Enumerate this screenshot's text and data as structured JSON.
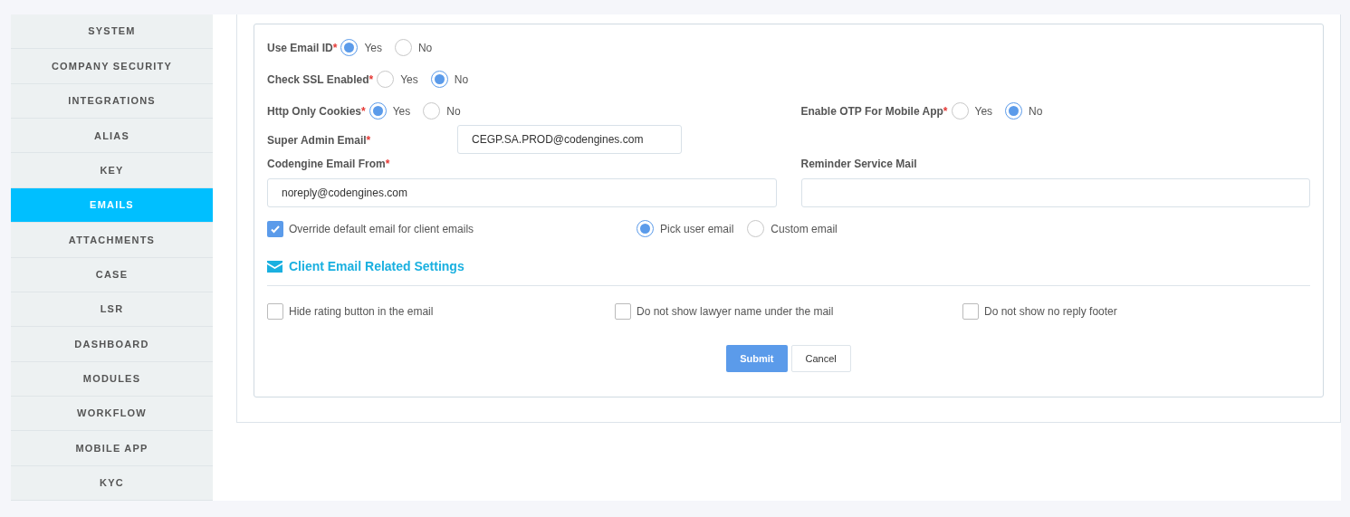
{
  "sidebar": {
    "items": [
      {
        "label": "SYSTEM",
        "selected": false
      },
      {
        "label": "COMPANY SECURITY",
        "selected": false
      },
      {
        "label": "INTEGRATIONS",
        "selected": false
      },
      {
        "label": "ALIAS",
        "selected": false
      },
      {
        "label": "KEY",
        "selected": false
      },
      {
        "label": "EMAILS",
        "selected": true
      },
      {
        "label": "ATTACHMENTS",
        "selected": false
      },
      {
        "label": "CASE",
        "selected": false
      },
      {
        "label": "LSR",
        "selected": false
      },
      {
        "label": "DASHBOARD",
        "selected": false
      },
      {
        "label": "MODULES",
        "selected": false
      },
      {
        "label": "WORKFLOW",
        "selected": false
      },
      {
        "label": "MOBILE APP",
        "selected": false
      },
      {
        "label": "KYC",
        "selected": false
      }
    ]
  },
  "form": {
    "radio_fields": [
      {
        "label": "Use Email ID",
        "required_mark": "*",
        "options": [
          {
            "label": "Yes",
            "selected": true
          },
          {
            "label": "No",
            "selected": false
          }
        ]
      },
      {
        "label": "Check SSL Enabled",
        "required_mark": "*",
        "options": [
          {
            "label": "Yes",
            "selected": false
          },
          {
            "label": "No",
            "selected": true
          }
        ]
      },
      {
        "label": "Http Only Cookies",
        "required_mark": "*",
        "options": [
          {
            "label": "Yes",
            "selected": true
          },
          {
            "label": "No",
            "selected": false
          }
        ]
      },
      {
        "label": "Enable OTP For Mobile App",
        "required_mark": "*",
        "options": [
          {
            "label": "Yes",
            "selected": false
          },
          {
            "label": "No",
            "selected": true
          }
        ]
      }
    ],
    "text_fields": [
      {
        "label": "Super Admin Email",
        "required_mark": "*",
        "value": "CEGP.SA.PROD@codengines.com"
      },
      {
        "label": "Codengine Email From",
        "required_mark": "*",
        "value": "noreply@codengines.com"
      },
      {
        "label": "Reminder Service Mail"
      }
    ],
    "override": {
      "label": "Override default email for client emails",
      "checked": true
    },
    "email_source": [
      {
        "label": "Pick user email",
        "selected": true
      },
      {
        "label": "Custom email",
        "selected": false
      }
    ],
    "section_title": "Client Email Related Settings",
    "client_options": [
      {
        "label": "Hide rating button in the email",
        "checked": false
      },
      {
        "label": "Do not show lawyer name under the mail",
        "checked": false
      },
      {
        "label": "Do not show no reply footer",
        "checked": false
      }
    ],
    "buttons": [
      {
        "label": "Submit",
        "kind": "primary"
      },
      {
        "label": "Cancel",
        "kind": "secondary"
      }
    ]
  }
}
